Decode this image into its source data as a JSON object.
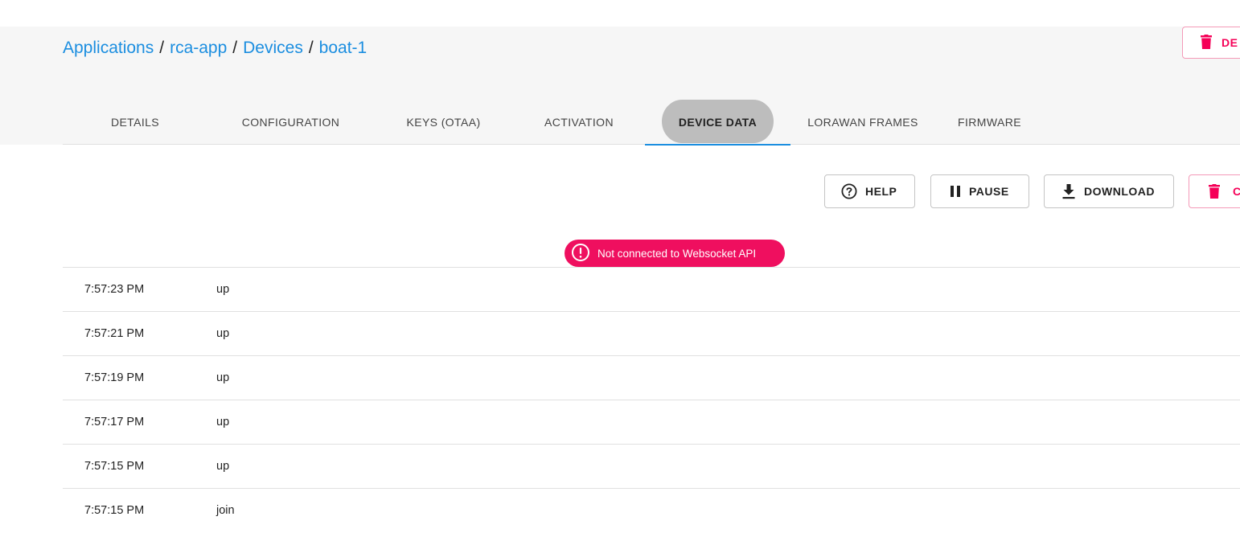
{
  "breadcrumb": {
    "applications": "Applications",
    "app": "rca-app",
    "devices": "Devices",
    "device": "boat-1",
    "separator": "/"
  },
  "header_actions": {
    "delete_label": "DE",
    "delete_icon": "trash-icon"
  },
  "tabs": [
    {
      "label": "DETAILS",
      "active": false
    },
    {
      "label": "CONFIGURATION",
      "active": false
    },
    {
      "label": "KEYS (OTAA)",
      "active": false
    },
    {
      "label": "ACTIVATION",
      "active": false
    },
    {
      "label": "DEVICE DATA",
      "active": true
    },
    {
      "label": "LORAWAN FRAMES",
      "active": false
    },
    {
      "label": "FIRMWARE",
      "active": false
    }
  ],
  "toolbar": {
    "help_label": "HELP",
    "help_icon": "help-circle-icon",
    "pause_label": "PAUSE",
    "pause_icon": "pause-icon",
    "download_label": "DOWNLOAD",
    "download_icon": "download-icon",
    "clear_label": "C",
    "clear_icon": "trash-icon"
  },
  "status": {
    "message": "Not connected to Websocket API",
    "icon": "alert-circle-icon"
  },
  "events": [
    {
      "time": "7:57:23 PM",
      "type": "up"
    },
    {
      "time": "7:57:21 PM",
      "type": "up"
    },
    {
      "time": "7:57:19 PM",
      "type": "up"
    },
    {
      "time": "7:57:17 PM",
      "type": "up"
    },
    {
      "time": "7:57:15 PM",
      "type": "up"
    },
    {
      "time": "7:57:15 PM",
      "type": "join"
    }
  ],
  "colors": {
    "link": "#1b8ee0",
    "accent_pink": "#f50057",
    "error_badge": "#ef0f5f",
    "active_tab_indicator": "#1b8ee0",
    "header_background": "#f6f6f6"
  }
}
